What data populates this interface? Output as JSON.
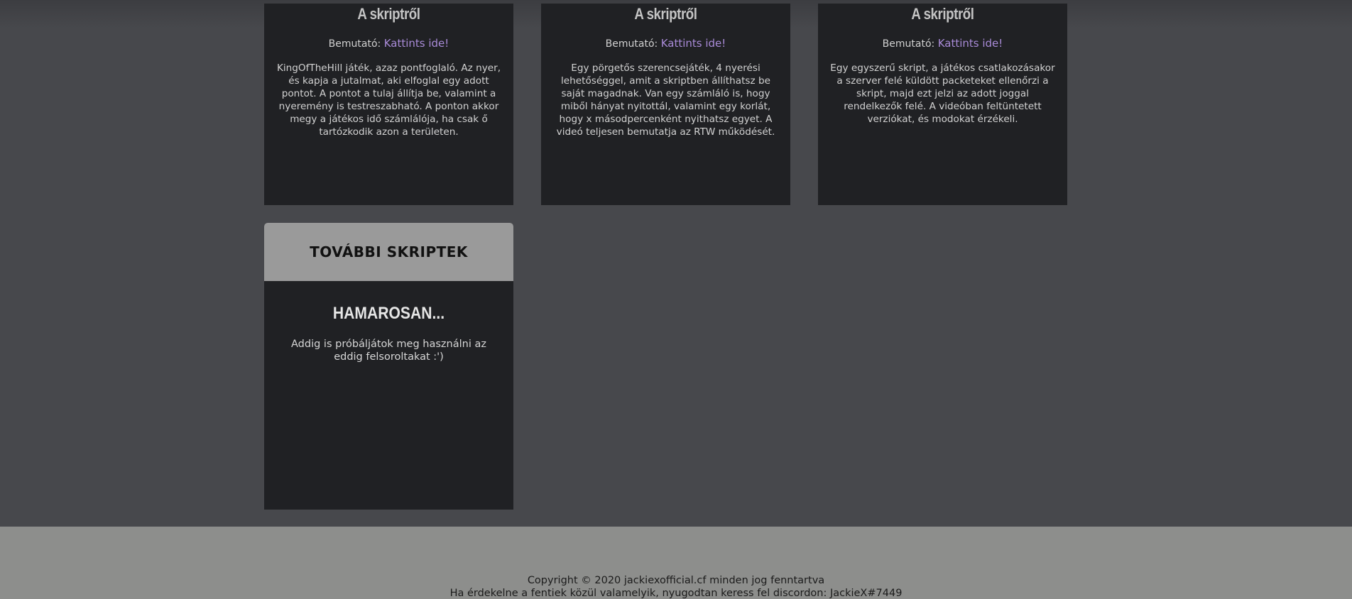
{
  "cards": [
    {
      "title": "A skriptről",
      "demo_label": "Bemutató:",
      "demo_link": "Kattints ide!",
      "description": "KingOfTheHill játék, azaz pontfoglaló. Az nyer, és kapja a jutalmat, aki elfoglal egy adott pontot. A pontot a tulaj állítja be, valamint a nyeremény is testreszabható. A ponton akkor megy a játékos idő számlálója, ha csak ő tartózkodik azon a területen."
    },
    {
      "title": "A skriptről",
      "demo_label": "Bemutató:",
      "demo_link": "Kattints ide!",
      "description": "Egy pörgetős szerencsejáték, 4 nyerési lehetőséggel, amit a skriptben állíthatsz be saját magadnak. Van egy számláló is, hogy miből hányat nyitottál, valamint egy korlát, hogy x másodpercenként nyithatsz egyet. A videó teljesen bemutatja az RTW működését."
    },
    {
      "title": "A skriptről",
      "demo_label": "Bemutató:",
      "demo_link": "Kattints ide!",
      "description": "Egy egyszerű skript, a játékos csatlakozásakor a szerver felé küldött packeteket ellenőrzi a skript, majd ezt jelzi az adott joggal rendelkezők felé. A videóban feltüntetett verziókat, és modokat érzékeli."
    }
  ],
  "more": {
    "header": "TOVÁBBI SKRIPTEK",
    "title": "HAMAROSAN...",
    "text": "Addig is próbáljátok meg használni az eddig felsoroltakat :')"
  },
  "footer": {
    "copyright": "Copyright © 2020 jackiexofficial.cf minden jog fenntartva",
    "contact": "Ha érdekelne a fentiek közül valamelyik, nyugodtan keress fel discordon: JackieX#7449"
  },
  "colors": {
    "background": "#47484c",
    "card": "#202124",
    "link": "#a98bd8",
    "header_band": "#9a9a9a",
    "footer": "#8d8e8c"
  }
}
